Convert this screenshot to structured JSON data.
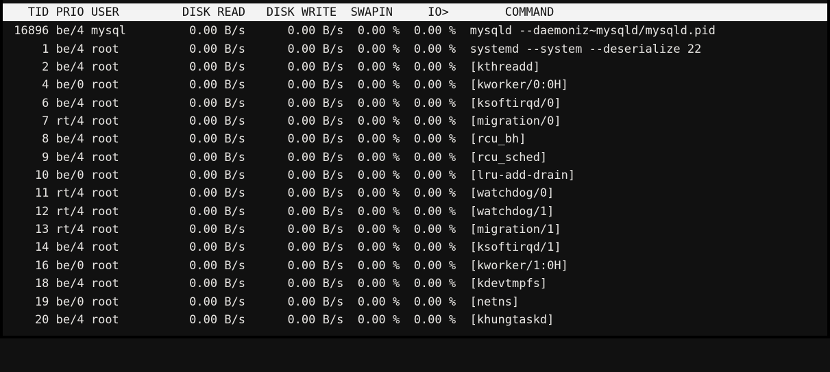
{
  "columns": [
    "TID",
    "PRIO",
    "USER",
    "DISK READ",
    "DISK WRITE",
    "SWAPIN",
    "IO>",
    "COMMAND"
  ],
  "processes": [
    {
      "tid": "16896",
      "prio": "be/4",
      "user": "mysql",
      "disk_read": "0.00 B/s",
      "disk_write": "0.00 B/s",
      "swapin": "0.00 %",
      "io": "0.00 %",
      "command": "mysqld --daemoniz~mysqld/mysqld.pid"
    },
    {
      "tid": "1",
      "prio": "be/4",
      "user": "root",
      "disk_read": "0.00 B/s",
      "disk_write": "0.00 B/s",
      "swapin": "0.00 %",
      "io": "0.00 %",
      "command": "systemd --system --deserialize 22"
    },
    {
      "tid": "2",
      "prio": "be/4",
      "user": "root",
      "disk_read": "0.00 B/s",
      "disk_write": "0.00 B/s",
      "swapin": "0.00 %",
      "io": "0.00 %",
      "command": "[kthreadd]"
    },
    {
      "tid": "4",
      "prio": "be/0",
      "user": "root",
      "disk_read": "0.00 B/s",
      "disk_write": "0.00 B/s",
      "swapin": "0.00 %",
      "io": "0.00 %",
      "command": "[kworker/0:0H]"
    },
    {
      "tid": "6",
      "prio": "be/4",
      "user": "root",
      "disk_read": "0.00 B/s",
      "disk_write": "0.00 B/s",
      "swapin": "0.00 %",
      "io": "0.00 %",
      "command": "[ksoftirqd/0]"
    },
    {
      "tid": "7",
      "prio": "rt/4",
      "user": "root",
      "disk_read": "0.00 B/s",
      "disk_write": "0.00 B/s",
      "swapin": "0.00 %",
      "io": "0.00 %",
      "command": "[migration/0]"
    },
    {
      "tid": "8",
      "prio": "be/4",
      "user": "root",
      "disk_read": "0.00 B/s",
      "disk_write": "0.00 B/s",
      "swapin": "0.00 %",
      "io": "0.00 %",
      "command": "[rcu_bh]"
    },
    {
      "tid": "9",
      "prio": "be/4",
      "user": "root",
      "disk_read": "0.00 B/s",
      "disk_write": "0.00 B/s",
      "swapin": "0.00 %",
      "io": "0.00 %",
      "command": "[rcu_sched]"
    },
    {
      "tid": "10",
      "prio": "be/0",
      "user": "root",
      "disk_read": "0.00 B/s",
      "disk_write": "0.00 B/s",
      "swapin": "0.00 %",
      "io": "0.00 %",
      "command": "[lru-add-drain]"
    },
    {
      "tid": "11",
      "prio": "rt/4",
      "user": "root",
      "disk_read": "0.00 B/s",
      "disk_write": "0.00 B/s",
      "swapin": "0.00 %",
      "io": "0.00 %",
      "command": "[watchdog/0]"
    },
    {
      "tid": "12",
      "prio": "rt/4",
      "user": "root",
      "disk_read": "0.00 B/s",
      "disk_write": "0.00 B/s",
      "swapin": "0.00 %",
      "io": "0.00 %",
      "command": "[watchdog/1]"
    },
    {
      "tid": "13",
      "prio": "rt/4",
      "user": "root",
      "disk_read": "0.00 B/s",
      "disk_write": "0.00 B/s",
      "swapin": "0.00 %",
      "io": "0.00 %",
      "command": "[migration/1]"
    },
    {
      "tid": "14",
      "prio": "be/4",
      "user": "root",
      "disk_read": "0.00 B/s",
      "disk_write": "0.00 B/s",
      "swapin": "0.00 %",
      "io": "0.00 %",
      "command": "[ksoftirqd/1]"
    },
    {
      "tid": "16",
      "prio": "be/0",
      "user": "root",
      "disk_read": "0.00 B/s",
      "disk_write": "0.00 B/s",
      "swapin": "0.00 %",
      "io": "0.00 %",
      "command": "[kworker/1:0H]"
    },
    {
      "tid": "18",
      "prio": "be/4",
      "user": "root",
      "disk_read": "0.00 B/s",
      "disk_write": "0.00 B/s",
      "swapin": "0.00 %",
      "io": "0.00 %",
      "command": "[kdevtmpfs]"
    },
    {
      "tid": "19",
      "prio": "be/0",
      "user": "root",
      "disk_read": "0.00 B/s",
      "disk_write": "0.00 B/s",
      "swapin": "0.00 %",
      "io": "0.00 %",
      "command": "[netns]"
    },
    {
      "tid": "20",
      "prio": "be/4",
      "user": "root",
      "disk_read": "0.00 B/s",
      "disk_write": "0.00 B/s",
      "swapin": "0.00 %",
      "io": "0.00 %",
      "command": "[khungtaskd]"
    }
  ],
  "widths": {
    "tid": 6,
    "prio": 5,
    "user": 11,
    "disk_read": 11,
    "disk_write": 11,
    "swapin": 8,
    "io": 8
  }
}
